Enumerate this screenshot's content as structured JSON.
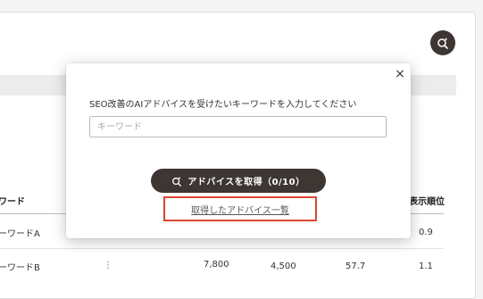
{
  "table": {
    "headers": {
      "keyword": "ワード",
      "rank": "表示順位"
    },
    "rows": [
      {
        "keyword": "ーワードA",
        "rank": "0.9"
      },
      {
        "keyword": "ーワードB",
        "menu": "⋮",
        "v1": "7,800",
        "v2": "4,500",
        "v3": "57.7",
        "rank": "1.1"
      }
    ]
  },
  "modal": {
    "prompt": "SEO改善のAIアドバイスを受けたいキーワードを入力してください",
    "input_placeholder": "キーワード",
    "input_value": "",
    "get_button_label": "アドバイスを取得（0/10）",
    "list_link_label": "取得したアドバイス一覧",
    "close_symbol": "×"
  },
  "icons": {
    "fab": "ai-search-icon",
    "button": "ai-search-icon",
    "close": "close-icon"
  },
  "colors": {
    "dark_button": "#3d3633",
    "highlight_border": "#d9462e"
  }
}
